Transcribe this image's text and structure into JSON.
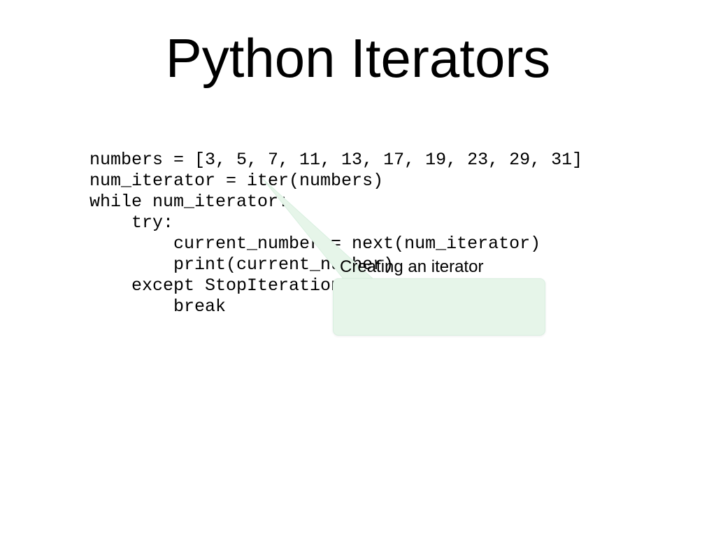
{
  "title": "Python Iterators",
  "code": {
    "line1": "numbers = [3, 5, 7, 11, 13, 17, 19, 23, 29, 31]",
    "line2": "num_iterator = iter(numbers)",
    "line3": "while num_iterator:",
    "line4": "    try:",
    "line5": "        current_number = next(num_iterator)",
    "line6": "        print(current_number)",
    "line7": "    except StopIteration:",
    "line8": "        break"
  },
  "callout": {
    "label": "Creating an iterator"
  }
}
